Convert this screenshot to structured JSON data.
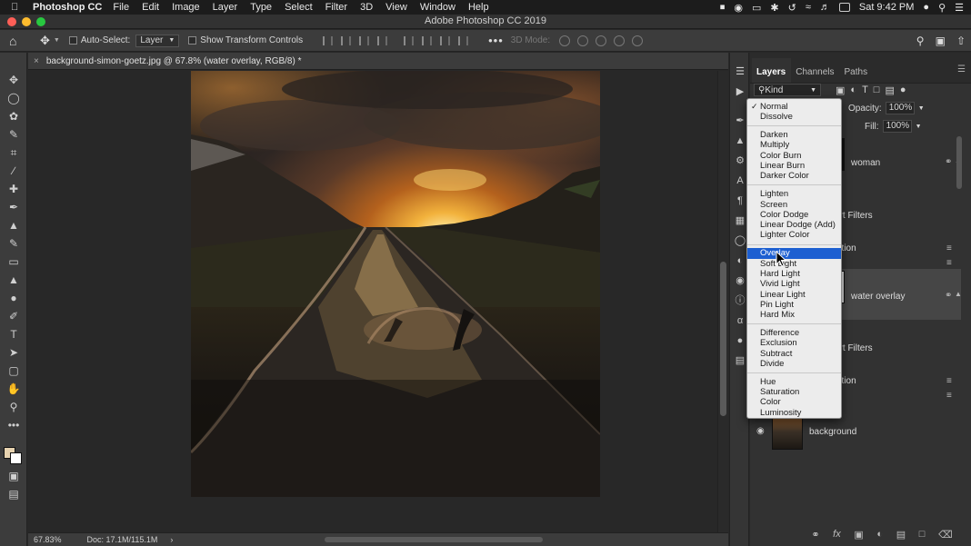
{
  "menubar": {
    "app_name": "Photoshop CC",
    "items": [
      "File",
      "Edit",
      "Image",
      "Layer",
      "Type",
      "Select",
      "Filter",
      "3D",
      "View",
      "Window",
      "Help"
    ],
    "clock": "Sat 9:42 PM"
  },
  "window": {
    "title": "Adobe Photoshop CC 2019"
  },
  "options_bar": {
    "auto_select_label": "Auto-Select:",
    "auto_select_target": "Layer",
    "show_transform_label": "Show Transform Controls",
    "mode_3d_label": "3D Mode:"
  },
  "document": {
    "tab_title": "background-simon-goetz.jpg @ 67.8% (water overlay, RGB/8) *",
    "zoom": "67.83%",
    "doc_size": "Doc: 17.1M/115.1M"
  },
  "layers_panel": {
    "tabs": [
      "Layers",
      "Channels",
      "Paths"
    ],
    "filter_kind": "Kind",
    "opacity_label": "Opacity:",
    "opacity_value": "100%",
    "fill_label": "Fill:",
    "fill_value": "100%",
    "layers": [
      {
        "name": "woman"
      },
      {
        "name": "art Filters"
      },
      {
        "name": "ation"
      },
      {
        "name": "water overlay"
      },
      {
        "name": "art Filters"
      },
      {
        "name": "ation"
      },
      {
        "name": "background"
      }
    ]
  },
  "blend_menu": {
    "checked": "Normal",
    "highlighted": "Overlay",
    "groups": [
      [
        "Normal",
        "Dissolve"
      ],
      [
        "Darken",
        "Multiply",
        "Color Burn",
        "Linear Burn",
        "Darker Color"
      ],
      [
        "Lighten",
        "Screen",
        "Color Dodge",
        "Linear Dodge (Add)",
        "Lighter Color"
      ],
      [
        "Overlay",
        "Soft Light",
        "Hard Light",
        "Vivid Light",
        "Linear Light",
        "Pin Light",
        "Hard Mix"
      ],
      [
        "Difference",
        "Exclusion",
        "Subtract",
        "Divide"
      ],
      [
        "Hue",
        "Saturation",
        "Color",
        "Luminosity"
      ]
    ]
  },
  "colors": {
    "foreground": "#e7d3b0",
    "background": "#ffffff",
    "highlight": "#1d5fd1"
  }
}
